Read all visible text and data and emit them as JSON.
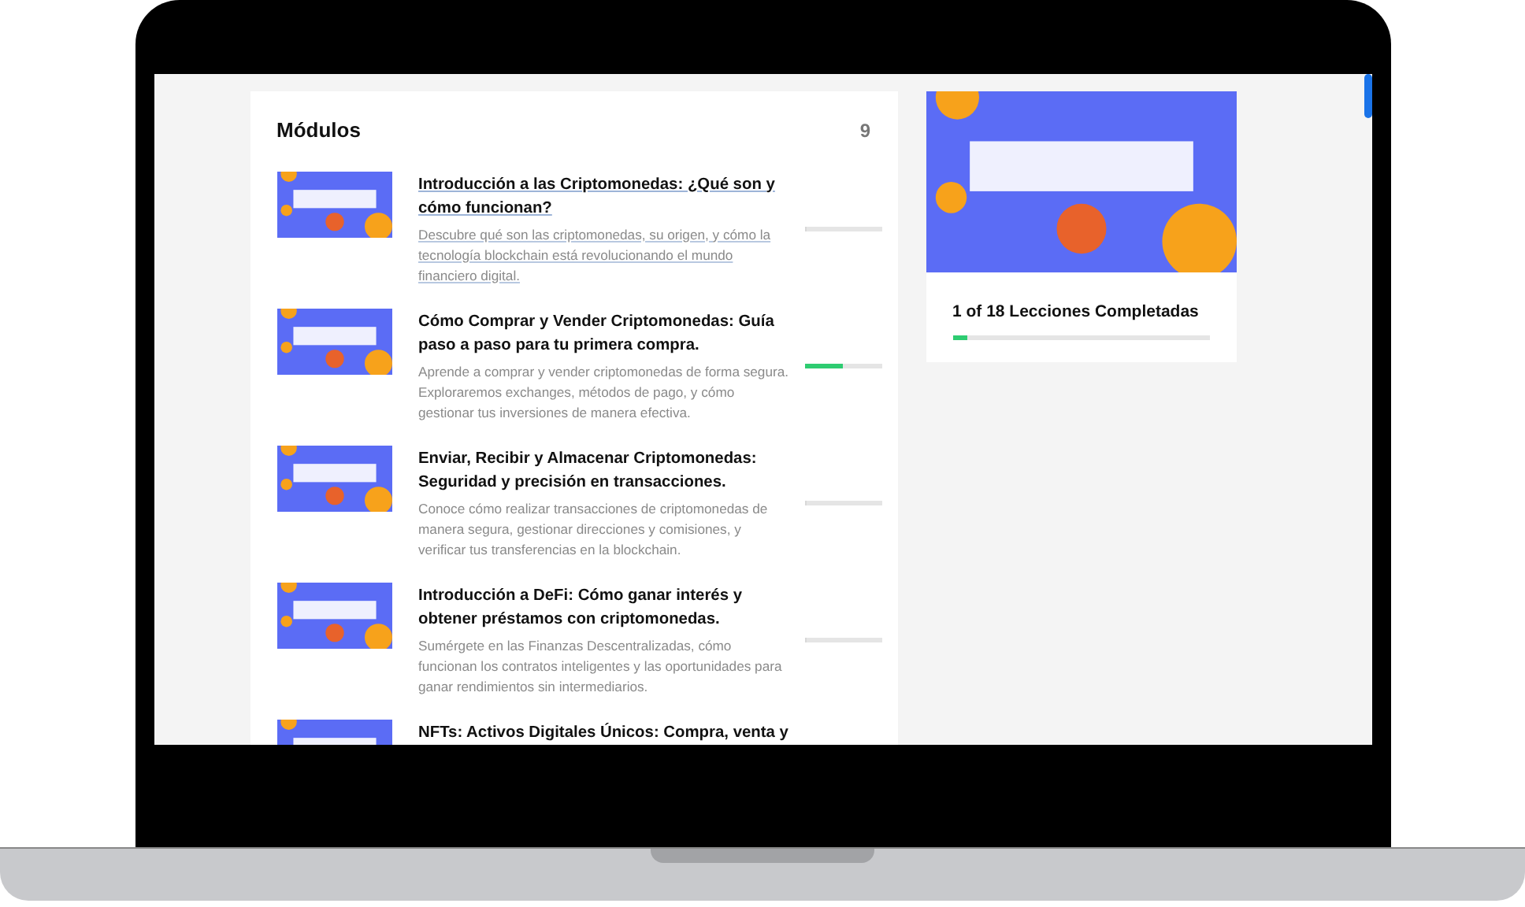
{
  "modules": {
    "title": "Módulos",
    "count": "9",
    "items": [
      {
        "title": "Introducción a las Criptomonedas: ¿Qué son y cómo funcionan?",
        "description": "Descubre qué son las criptomonedas, su origen, y cómo la tecnología blockchain está revolucionando el mundo financiero digital.",
        "hovered": true,
        "level": 0
      },
      {
        "title": "Cómo Comprar y Vender Criptomonedas: Guía paso a paso para tu primera compra.",
        "description": "Aprende a comprar y vender criptomonedas de forma segura. Exploraremos exchanges, métodos de pago, y cómo gestionar tus inversiones de manera efectiva.",
        "hovered": false,
        "level": 0.5
      },
      {
        "title": "Enviar, Recibir y Almacenar Criptomonedas: Seguridad y precisión en transacciones.",
        "description": "Conoce cómo realizar transacciones de criptomonedas de manera segura, gestionar direcciones y comisiones, y verificar tus transferencias en la blockchain.",
        "hovered": false,
        "level": 0
      },
      {
        "title": "Introducción a DeFi: Cómo ganar interés y obtener préstamos con criptomonedas.",
        "description": "Sumérgete en las Finanzas Descentralizadas, cómo funcionan los contratos inteligentes y las oportunidades para ganar rendimientos sin intermediarios.",
        "hovered": false,
        "level": 0
      },
      {
        "title": "NFTs: Activos Digitales Únicos: Compra, venta y",
        "hovered": false
      }
    ]
  },
  "course": {
    "progress_text": "1 of 18 Lecciones Completadas",
    "level": 0.06
  }
}
